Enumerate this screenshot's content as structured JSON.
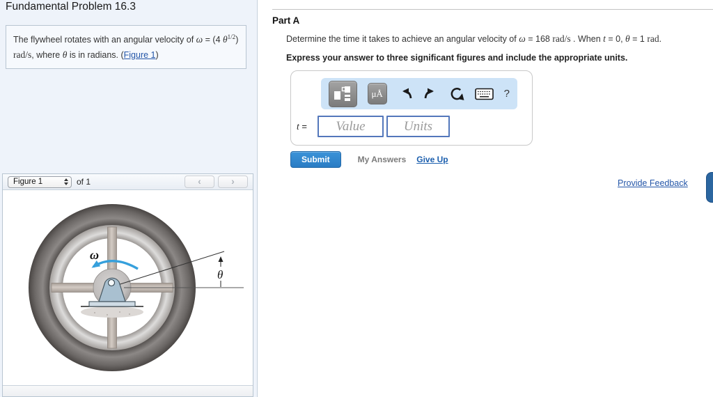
{
  "page_title": "Fundamental Problem 16.3",
  "problem": {
    "a": "The flywheel rotates with an angular velocity of ",
    "omega": "ω",
    "b": " = (4 ",
    "theta": "θ",
    "exponent": "1/2",
    "c": ") ",
    "rad_s": "rad/s",
    "d": ", where ",
    "theta2": "θ",
    "e": " is in radians. (",
    "figure_link": "Figure 1",
    "f": ")"
  },
  "figure_bar": {
    "selector": "Figure 1",
    "of": "of 1",
    "prev": "‹",
    "next": "›"
  },
  "figure": {
    "omega": "ω",
    "theta": "θ"
  },
  "part_a": {
    "heading": "Part A",
    "question": {
      "a": "Determine the time it takes to achieve an angular velocity of ",
      "omega": "ω",
      "b": " = 168 ",
      "rad_s": "rad/s",
      "c": " . When ",
      "t": "t",
      "d": " = 0, ",
      "theta": "θ",
      "e": " = 1 ",
      "rad": "rad",
      "f": "."
    },
    "instruction": "Express your answer to three significant figures and include the appropriate units.",
    "toolbar": {
      "mu_button": "μÅ",
      "help": "?"
    },
    "answer": {
      "variable": "t",
      "equals": " = ",
      "value_placeholder": "Value",
      "units_placeholder": "Units"
    },
    "submit": "Submit",
    "my_answers": "My Answers",
    "give_up": "Give Up"
  },
  "footer": {
    "provide_feedback": "Provide Feedback"
  },
  "colors": {
    "left_panel_bg": "#eef3fa",
    "toolbar_bg": "#cde3f7",
    "submit_blue": "#2e85cc",
    "link_blue": "#2456a8",
    "input_border": "#5377bb",
    "omega_arrow": "#36a0dc",
    "edge_tab": "#2b66a0"
  }
}
